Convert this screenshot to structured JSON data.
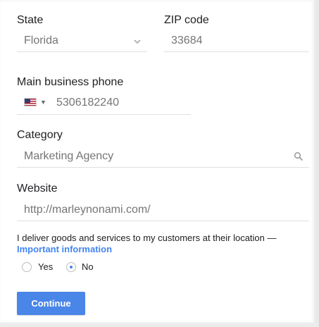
{
  "form": {
    "state": {
      "label": "State",
      "value": "Florida"
    },
    "zip": {
      "label": "ZIP code",
      "value": "33684"
    },
    "phone": {
      "label": "Main business phone",
      "value": "5306182240",
      "country_icon": "us-flag-icon"
    },
    "category": {
      "label": "Category",
      "value": "Marketing Agency"
    },
    "website": {
      "label": "Website",
      "value": "http://marleynonami.com/"
    },
    "delivery": {
      "question": "I deliver goods and services to my customers at their location —",
      "link": "Important information",
      "options": [
        {
          "label": "Yes",
          "selected": false
        },
        {
          "label": "No",
          "selected": true
        }
      ]
    },
    "continue_label": "Continue"
  },
  "colors": {
    "accent": "#4285f4",
    "button": "#4a85e8",
    "divider": "#e0e0e0",
    "muted_text": "#757575"
  }
}
